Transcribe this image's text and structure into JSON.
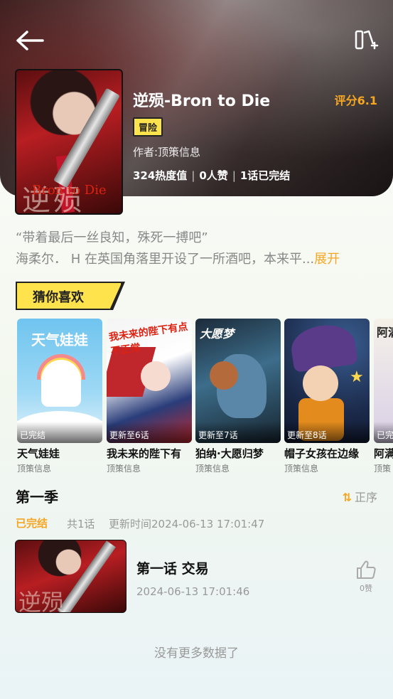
{
  "comic": {
    "title": "逆殒-Bron to Die",
    "rating": "评分6.1",
    "tag": "冒险",
    "author": "作者:顶策信息",
    "heat": "324热度值",
    "likes": "0人赞",
    "chapters": "1话已完结",
    "cover_text": "逆殒",
    "cover_sub": "Bron to Die",
    "desc_line1": "“带着最后一丝良知，殊死一搏吧”",
    "desc_line2": "海柔尔． H 在英国角落里开设了一所酒吧，本来平...",
    "expand_label": "展开"
  },
  "recommend": {
    "section_label": "猜你喜欢",
    "items": [
      {
        "name": "天气娃娃",
        "author": "顶策信息",
        "badge": "已完结",
        "thumb_text": "天气娃娃"
      },
      {
        "name": "我未来的陛下有",
        "author": "顶策信息",
        "badge": "更新至6话",
        "thumb_text": "我未来的陛下有点不正常"
      },
      {
        "name": "狛纳·大愿归梦",
        "author": "顶策信息",
        "badge": "更新至7话",
        "thumb_text": "大愿梦"
      },
      {
        "name": "帽子女孩在边缘",
        "author": "顶策信息",
        "badge": "更新至8话",
        "thumb_text": ""
      },
      {
        "name": "阿满",
        "author": "顶策",
        "badge": "已完",
        "thumb_text": "阿满"
      }
    ]
  },
  "season": {
    "title": "第一季",
    "sort_label": "正序",
    "status": "已完结",
    "count": "共1话",
    "updated": "更新时间2024-06-13 17:01:47"
  },
  "episodes": [
    {
      "title": "第一话  交易",
      "date": "2024-06-13 17:01:46",
      "likes": "0赞",
      "thumb_text": "逆殒"
    }
  ],
  "footer": {
    "no_more": "没有更多数据了"
  },
  "colors": {
    "accent": "#f5a623",
    "tag_bg": "#ffe34d"
  }
}
